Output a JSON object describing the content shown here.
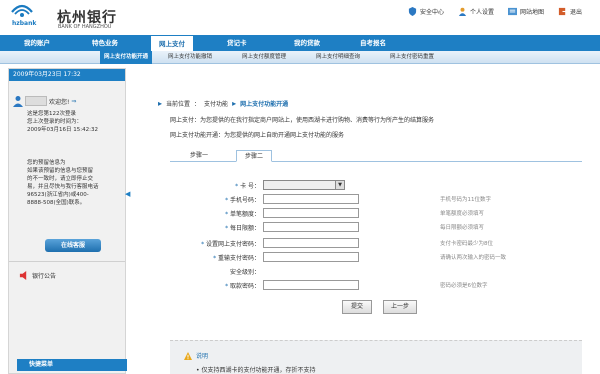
{
  "header": {
    "brand_en_short": "hzbank",
    "brand_cn": "杭州银行",
    "brand_en": "BANK OF HANGZHOU",
    "links": [
      {
        "label": "安全中心",
        "icon": "shield-icon"
      },
      {
        "label": "个人设置",
        "icon": "person-icon"
      },
      {
        "label": "网站地图",
        "icon": "sitemap-icon"
      },
      {
        "label": "退出",
        "icon": "exit-icon"
      }
    ]
  },
  "mainnav": [
    "我的账户",
    "特色业务",
    "网上支付",
    "贷记卡",
    "我的贷款",
    "自考报名"
  ],
  "subnav": [
    "网上支付功能开通",
    "网上支付功能撤销",
    "网上支付额度管理",
    "网上支付明细查询",
    "网上支付密码重置"
  ],
  "left": {
    "date": "2009年03月23日 17:32",
    "welcome": "欢迎您!",
    "info_lines": [
      "这是您第122次登录",
      "您上次登录的时间为：",
      "2009年03月16日 15:42:32"
    ],
    "notice_lines": [
      "您的预留信息为",
      "如果该预留的信息与您预留",
      "的不一致时，请立即停止交",
      "易，并且尽快与我行客服电话",
      "96523(浙江省内)或400-",
      "8888-508(全国)联系。"
    ],
    "service_btn": "在线客服",
    "announce": "银行公告",
    "quick": "快捷菜单"
  },
  "content": {
    "crumb_prefix": "当前位置",
    "crumb_parent": "支付功能",
    "crumb_current": "网上支付功能开通",
    "desc1_label": "网上支付：",
    "desc1": "为您提供的在我行指定商户网站上，使用西湖卡进行购物、消费等行为所产生的结算服务",
    "desc2_label": "网上支付功能开通：",
    "desc2": "为您提供的网上自助开通网上支付功能的服务",
    "tabs": [
      "步骤一",
      "步骤二"
    ],
    "fields": [
      {
        "label": "卡 号：",
        "hint": ""
      },
      {
        "label": "手机号码：",
        "hint": "手机号码为11位数字"
      },
      {
        "label": "单笔额度：",
        "hint": "单笔额度必须填写"
      },
      {
        "label": "每日限额：",
        "hint": "每日限额必须填写"
      },
      {
        "label": "设置网上支付密码：",
        "hint": "支付卡密码最少为8位"
      },
      {
        "label": "重输支付密码：",
        "hint": "请确认两次输入的密码一致"
      },
      {
        "label": "安全级别：",
        "hint": ""
      },
      {
        "label": "取款密码：",
        "hint": "密码必须是6位数字"
      }
    ],
    "submit": "提交",
    "prev": "上一步",
    "note_title": "说明",
    "note_body": "• 仅支持西湖卡的支付功能开通，存折不支持"
  }
}
